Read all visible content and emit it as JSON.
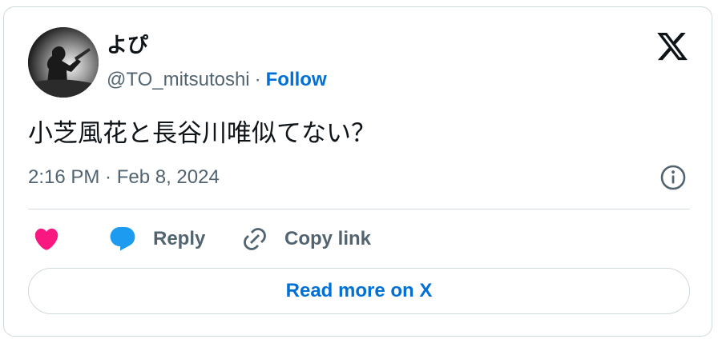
{
  "user": {
    "display_name": "よぴ",
    "handle": "@TO_mitsutoshi",
    "separator": "·",
    "follow_label": "Follow"
  },
  "tweet": {
    "text": "小芝風花と長谷川唯似てない？",
    "timestamp": "2:16 PM · Feb 8, 2024"
  },
  "actions": {
    "like_icon": "heart-icon",
    "reply_label": "Reply",
    "reply_icon": "speech-bubble-icon",
    "copy_link_label": "Copy link",
    "copy_link_icon": "link-icon"
  },
  "footer": {
    "read_more_label": "Read more on X"
  },
  "colors": {
    "accent": "#006fd6",
    "like": "#f91880",
    "reply": "#1d9bf0",
    "secondary_text": "#536471",
    "border": "#cfd9de"
  }
}
